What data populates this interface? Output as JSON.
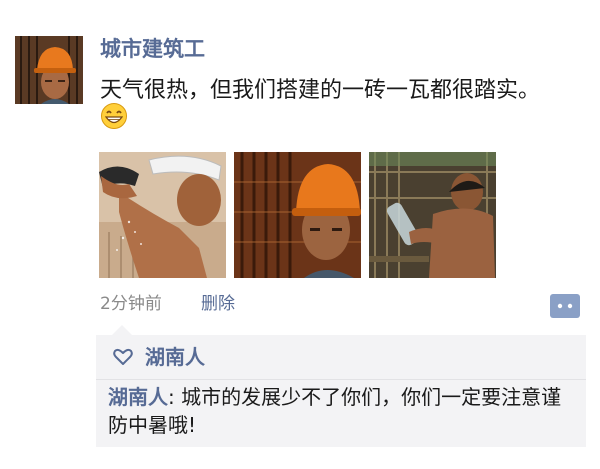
{
  "post": {
    "author": "城市建筑工",
    "text": "天气很热，但我们搭建的一砖一瓦都很踏实。",
    "emoji": "grinning-face-icon",
    "time": "2分钟前",
    "delete_label": "删除",
    "photos": [
      "worker-wiping-sweat-photo",
      "worker-orange-helmet-photo",
      "worker-drinking-water-photo"
    ]
  },
  "likes": {
    "names": "湖南人"
  },
  "comments": [
    {
      "author": "湖南人",
      "separator": ": ",
      "text": "城市的发展少不了你们，你们一定要注意谨防中暑哦!"
    }
  ],
  "colors": {
    "link": "#576b95",
    "comment_bg": "#f3f3f5",
    "meta_gray": "#8a8a8a"
  }
}
